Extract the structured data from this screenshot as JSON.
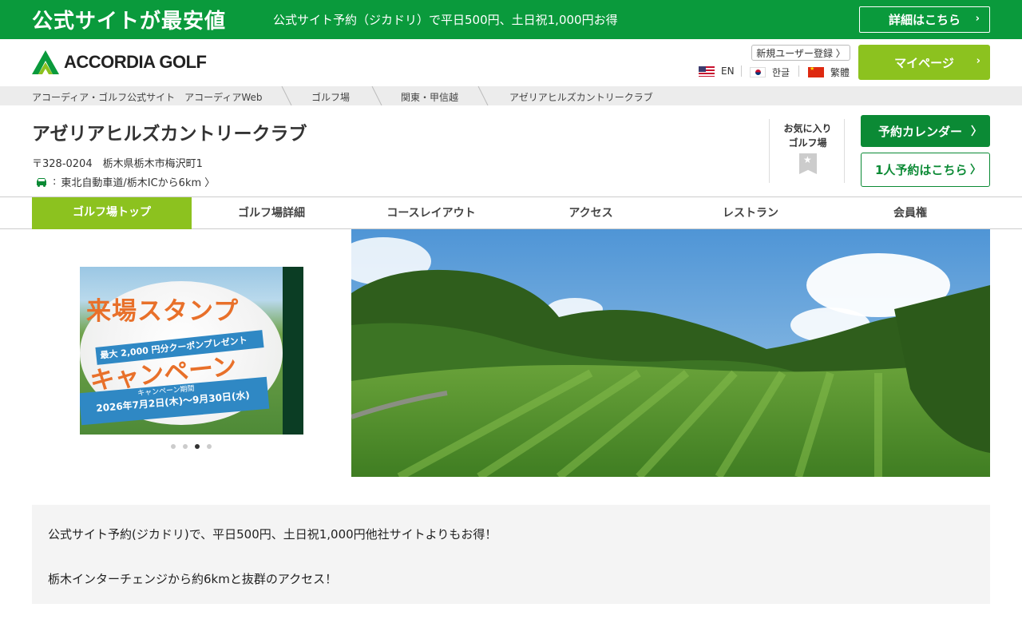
{
  "promo": {
    "title": "公式サイトが最安値",
    "text": "公式サイト予約（ジカドリ）で平日500円、土日祝1,000円お得",
    "button": "詳細はこちら",
    "chevron": "›",
    "color": "#0a9a3c"
  },
  "header": {
    "logo_text": "ACCORDIA GOLF",
    "register": "新規ユーザー登録 〉",
    "languages": [
      {
        "flag": "us-flag-icon",
        "label": "EN"
      },
      {
        "flag": "kr-flag-icon",
        "label": "한글"
      },
      {
        "flag": "cn-flag-icon",
        "label": "繁體"
      }
    ],
    "mypage": "マイページ",
    "chevron": "›",
    "mypage_color": "#8cc21f"
  },
  "breadcrumb": [
    "アコーディア・ゴルフ公式サイト　アコーディアWeb",
    "ゴルフ場",
    "関東・甲信越",
    "アゼリアヒルズカントリークラブ"
  ],
  "course": {
    "name": "アゼリアヒルズカントリークラブ",
    "address": "〒328-0204　栃木県栃木市梅沢町1",
    "access_prefix": ":",
    "access": "東北自動車道/栃木ICから6km 〉",
    "favorite_line1": "お気に入り",
    "favorite_line2": "ゴルフ場",
    "calendar_button": "予約カレンダー",
    "solo_button": "1人予約はこちら",
    "chevron": "〉",
    "accent": "#0b8a35"
  },
  "tabs": [
    {
      "label": "ゴルフ場トップ",
      "active": true
    },
    {
      "label": "ゴルフ場詳細",
      "active": false
    },
    {
      "label": "コースレイアウト",
      "active": false
    },
    {
      "label": "アクセス",
      "active": false
    },
    {
      "label": "レストラン",
      "active": false
    },
    {
      "label": "会員権",
      "active": false
    }
  ],
  "campaign": {
    "title1": "来場スタンプ",
    "subtitle": "最大 2,000 円分クーポンプレゼント",
    "title2": "キャンペーン",
    "period_label": "キャンペーン期間",
    "period": "2026年7月2日(木)〜9月30日(水)",
    "slides": 4,
    "active_slide": 3
  },
  "info": {
    "line1": "公式サイト予約(ジカドリ)で、平日500円、土日祝1,000円他社サイトよりもお得！",
    "line2": "栃木インターチェンジから約6kmと抜群のアクセス！"
  }
}
